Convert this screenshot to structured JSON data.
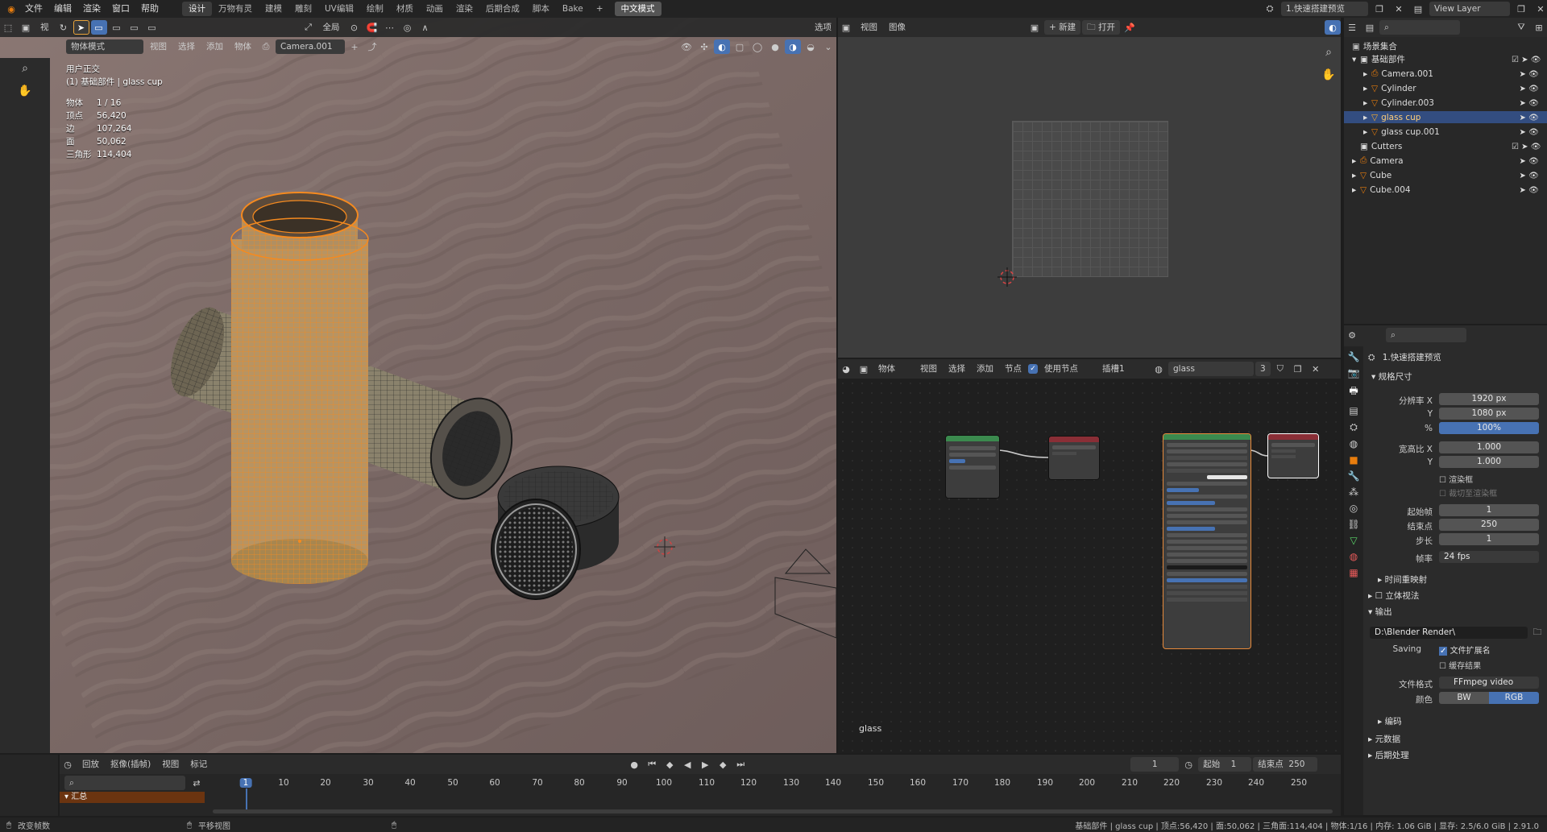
{
  "topbar": {
    "menus": [
      "文件",
      "编辑",
      "渲染",
      "窗口",
      "帮助"
    ],
    "workspaces": [
      "设计",
      "万物有灵",
      "建模",
      "雕刻",
      "UV编辑",
      "绘制",
      "材质",
      "动画",
      "渲染",
      "后期合成",
      "脚本",
      "Bake"
    ],
    "active_workspace": "设计",
    "plus": "+",
    "mode_button": "中文模式",
    "scene_name": "1.快速搭建预览",
    "view_layer": "View Layer"
  },
  "viewport": {
    "header": {
      "mode": "物体模式",
      "menus": [
        "视图",
        "选择",
        "添加",
        "物体"
      ],
      "camera": "Camera.001",
      "transform": "全局",
      "options": "选项"
    },
    "overlay_title": "用户正交",
    "overlay_subtitle": "(1) 基础部件 | glass cup",
    "stats": [
      {
        "label": "物体",
        "value": "1 / 16"
      },
      {
        "label": "顶点",
        "value": "56,420"
      },
      {
        "label": "边",
        "value": "107,264"
      },
      {
        "label": "面",
        "value": "50,062"
      },
      {
        "label": "三角形",
        "value": "114,404"
      }
    ]
  },
  "image_editor": {
    "menus": [
      "视图",
      "图像"
    ],
    "new_label": "新建",
    "open_label": "打开"
  },
  "node_editor": {
    "object_label": "物体",
    "menus": [
      "视图",
      "选择",
      "添加",
      "节点"
    ],
    "use_nodes": "使用节点",
    "slot": "插槽1",
    "material_name": "glass",
    "user_count": "3",
    "footer_label": "glass"
  },
  "outliner": {
    "root": "场景集合",
    "items": [
      {
        "name": "基础部件",
        "indent": 1,
        "type": "collection"
      },
      {
        "name": "Camera.001",
        "indent": 2,
        "type": "camera"
      },
      {
        "name": "Cylinder",
        "indent": 2,
        "type": "mesh"
      },
      {
        "name": "Cylinder.003",
        "indent": 2,
        "type": "mesh"
      },
      {
        "name": "glass cup",
        "indent": 2,
        "type": "mesh",
        "selected": true
      },
      {
        "name": "glass cup.001",
        "indent": 2,
        "type": "mesh"
      },
      {
        "name": "Cutters",
        "indent": 1,
        "type": "collection"
      },
      {
        "name": "Camera",
        "indent": 1,
        "type": "camera"
      },
      {
        "name": "Cube",
        "indent": 1,
        "type": "mesh"
      },
      {
        "name": "Cube.004",
        "indent": 1,
        "type": "mesh"
      }
    ]
  },
  "properties": {
    "scene_name": "1.快速搭建预览",
    "format_section": "规格尺寸",
    "res_x_label": "分辨率 X",
    "res_x": "1920 px",
    "res_y_label": "Y",
    "res_y": "1080 px",
    "pct_label": "%",
    "pct": "100%",
    "aspect_x_label": "宽高比 X",
    "aspect_x": "1.000",
    "aspect_y_label": "Y",
    "aspect_y": "1.000",
    "render_region": "渲染框",
    "crop": "裁切至渲染框",
    "frame_start_label": "起始帧",
    "frame_start": "1",
    "frame_end_label": "结束点",
    "frame_end": "250",
    "step_label": "步长",
    "step": "1",
    "fps_label": "帧率",
    "fps": "24 fps",
    "time_remap": "时间重映射",
    "stereo": "立体视法",
    "output_section": "输出",
    "output_path": "D:\\Blender Render\\",
    "saving_label": "Saving",
    "file_ext": "文件扩展名",
    "cache_result": "缓存结果",
    "file_format_label": "文件格式",
    "file_format": "FFmpeg video",
    "color_label": "颜色",
    "color_bw": "BW",
    "color_rgb": "RGB",
    "encoding": "编码",
    "metadata": "元数据",
    "post": "后期处理"
  },
  "timeline": {
    "menus": [
      "回放",
      "抠像(插帧)",
      "视图",
      "标记"
    ],
    "current_frame": "1",
    "start_label": "起始",
    "start": "1",
    "end_label": "结束点",
    "end": "250",
    "ticks": [
      "1",
      "10",
      "20",
      "30",
      "40",
      "50",
      "60",
      "70",
      "80",
      "90",
      "100",
      "110",
      "120",
      "130",
      "140",
      "150",
      "160",
      "170",
      "180",
      "190",
      "200",
      "210",
      "220",
      "230",
      "240",
      "250"
    ],
    "summary": "汇总"
  },
  "statusbar": {
    "left1": "改变帧数",
    "left2": "平移视图",
    "right": "基础部件 | glass cup | 顶点:56,420 | 面:50,062 | 三角面:114,404 | 物体:1/16 | 内存: 1.06 GiB | 显存: 2.5/6.0 GiB | 2.91.0"
  }
}
